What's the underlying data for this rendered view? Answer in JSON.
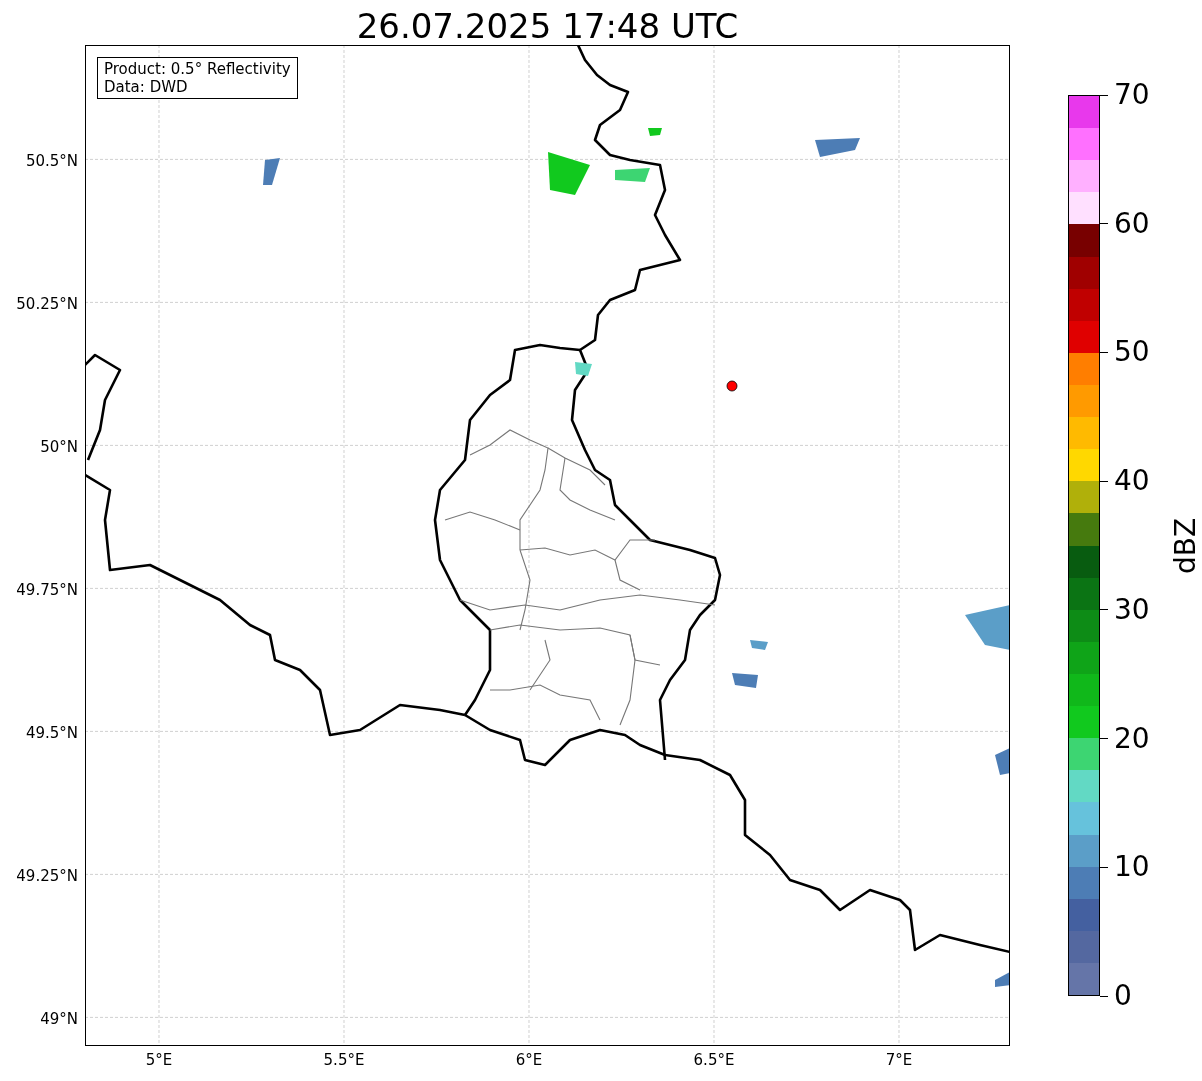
{
  "title": "26.07.2025 17:48 UTC",
  "info_box": [
    "Product: 0.5° Reflectivity",
    "Data: DWD"
  ],
  "lat_labels": [
    "50.5°N",
    "50.25°N",
    "50°N",
    "49.75°N",
    "49.5°N",
    "49.25°N",
    "49°N"
  ],
  "lon_labels": [
    "5°E",
    "5.5°E",
    "6°E",
    "6.5°E",
    "7°E"
  ],
  "colorbar": {
    "label": "dBZ",
    "ticks": [
      "70",
      "60",
      "50",
      "40",
      "30",
      "20",
      "10",
      "0"
    ],
    "segments": [
      {
        "color": "#e838ec"
      },
      {
        "color": "#ff70ff"
      },
      {
        "color": "#ffb0ff"
      },
      {
        "color": "#ffe0ff"
      },
      {
        "color": "#780000"
      },
      {
        "color": "#a00000"
      },
      {
        "color": "#c00000"
      },
      {
        "color": "#e00000"
      },
      {
        "color": "#ff7e00"
      },
      {
        "color": "#ff9a00"
      },
      {
        "color": "#ffba00"
      },
      {
        "color": "#ffd800"
      },
      {
        "color": "#b0b00a"
      },
      {
        "color": "#467a0e"
      },
      {
        "color": "#085c10"
      },
      {
        "color": "#0b7414"
      },
      {
        "color": "#0d8c16"
      },
      {
        "color": "#0fa418"
      },
      {
        "color": "#10b81a"
      },
      {
        "color": "#11c91e"
      },
      {
        "color": "#3dd572"
      },
      {
        "color": "#62d9c4"
      },
      {
        "color": "#66c2dc"
      },
      {
        "color": "#5b9ec8"
      },
      {
        "color": "#4d7db5"
      },
      {
        "color": "#4460a0"
      },
      {
        "color": "#5468a0"
      },
      {
        "color": "#6575a8"
      }
    ]
  }
}
